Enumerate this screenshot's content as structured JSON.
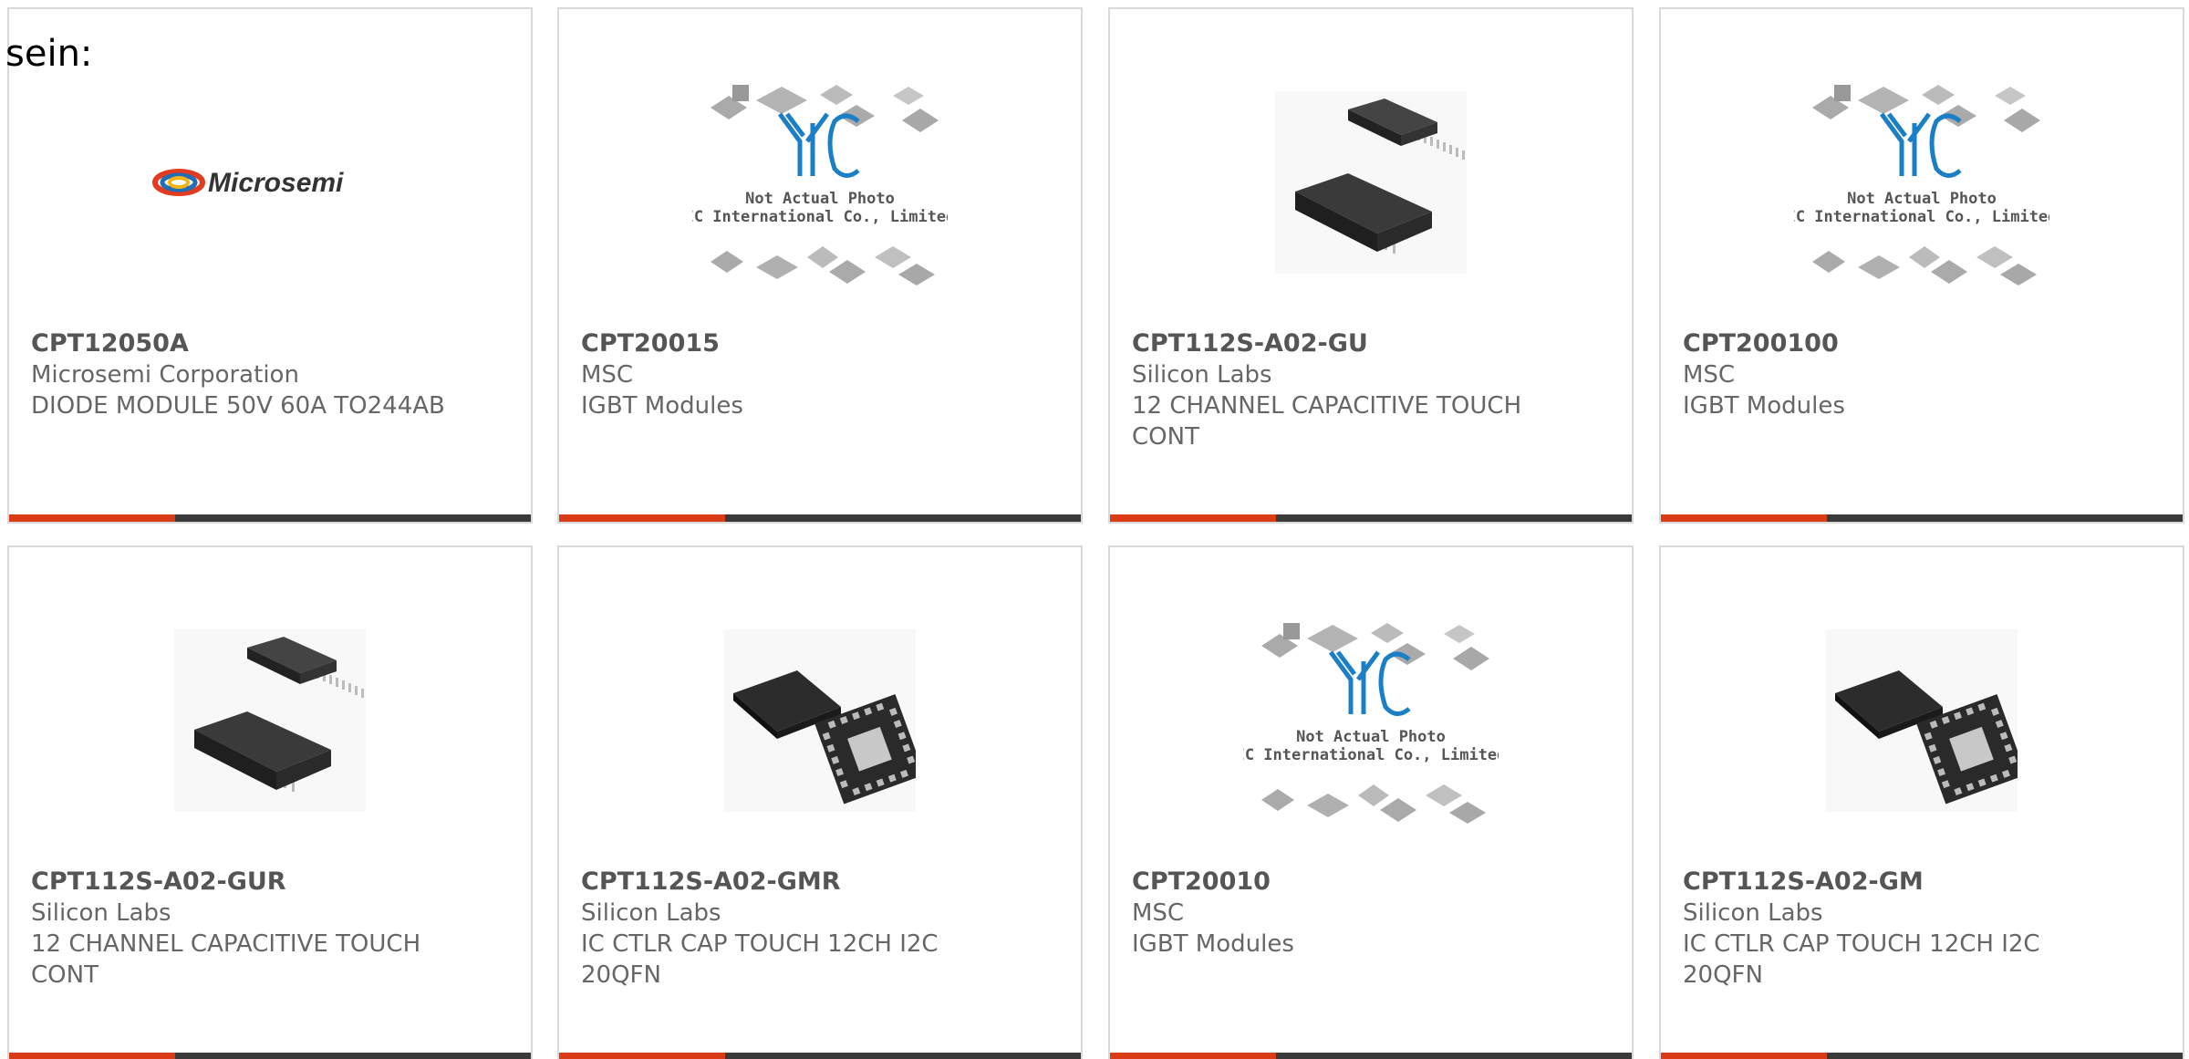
{
  "prefix_text": "sein:",
  "colors": {
    "accent": "#d93c17",
    "bar": "#3a3a3a",
    "border": "#d9d9d9",
    "text": "#666666",
    "yic_blue": "#1a7fc4"
  },
  "products": [
    {
      "part_number": "CPT12050A",
      "manufacturer": "Microsemi Corporation",
      "description": "DIODE MODULE 50V 60A TO244AB",
      "image": "microsemi-logo",
      "logo_text": "Microsemi"
    },
    {
      "part_number": "CPT20015",
      "manufacturer": "MSC",
      "description": "IGBT Modules",
      "image": "yic-placeholder",
      "placeholder_line1": "Not Actual Photo",
      "placeholder_line2": "YIC International Co., Limited."
    },
    {
      "part_number": "CPT112S-A02-GU",
      "manufacturer": "Silicon Labs",
      "description": "12 CHANNEL CAPACITIVE TOUCH CONT",
      "image": "ssop-chip"
    },
    {
      "part_number": "CPT200100",
      "manufacturer": "MSC",
      "description": "IGBT Modules",
      "image": "yic-placeholder",
      "placeholder_line1": "Not Actual Photo",
      "placeholder_line2": "YIC International Co., Limited."
    },
    {
      "part_number": "CPT112S-A02-GUR",
      "manufacturer": "Silicon Labs",
      "description": "12 CHANNEL CAPACITIVE TOUCH CONT",
      "image": "ssop-chip"
    },
    {
      "part_number": "CPT112S-A02-GMR",
      "manufacturer": "Silicon Labs",
      "description": "IC CTLR CAP TOUCH 12CH I2C 20QFN",
      "image": "qfn-chip"
    },
    {
      "part_number": "CPT20010",
      "manufacturer": "MSC",
      "description": "IGBT Modules",
      "image": "yic-placeholder",
      "placeholder_line1": "Not Actual Photo",
      "placeholder_line2": "YIC International Co., Limited."
    },
    {
      "part_number": "CPT112S-A02-GM",
      "manufacturer": "Silicon Labs",
      "description": "IC CTLR CAP TOUCH 12CH I2C 20QFN",
      "image": "qfn-chip"
    }
  ]
}
